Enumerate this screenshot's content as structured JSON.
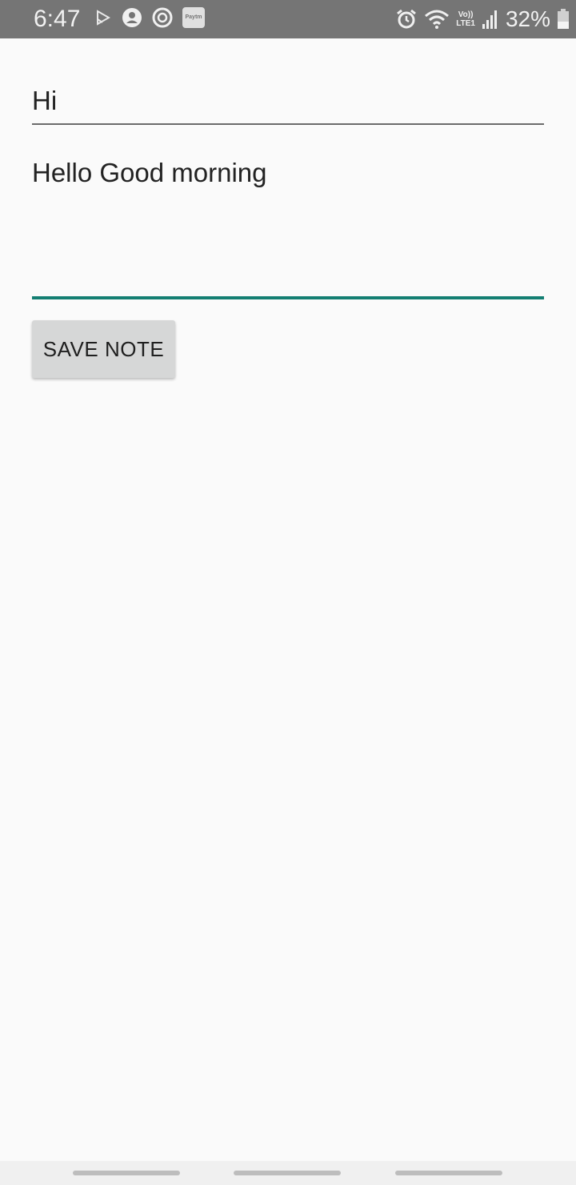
{
  "status_bar": {
    "time": "6:47",
    "left_icons": [
      "cast-icon",
      "account-circle-icon",
      "sync-circle-icon",
      "paytm-icon"
    ],
    "paytm_label": "Paytm",
    "lte_top": "Vo))",
    "lte_bottom": "LTE1",
    "battery_percent": "32%",
    "right_icons": [
      "alarm-icon",
      "wifi-icon",
      "volte-lte-icon",
      "signal-icon",
      "battery-icon"
    ]
  },
  "note": {
    "title_value": "Hi",
    "body_value": "Hello Good morning",
    "accent_color": "#137e72"
  },
  "actions": {
    "save_label": "SAVE NOTE"
  },
  "nav_bar": {
    "items": [
      "recents-pill",
      "home-pill",
      "back-pill"
    ]
  }
}
